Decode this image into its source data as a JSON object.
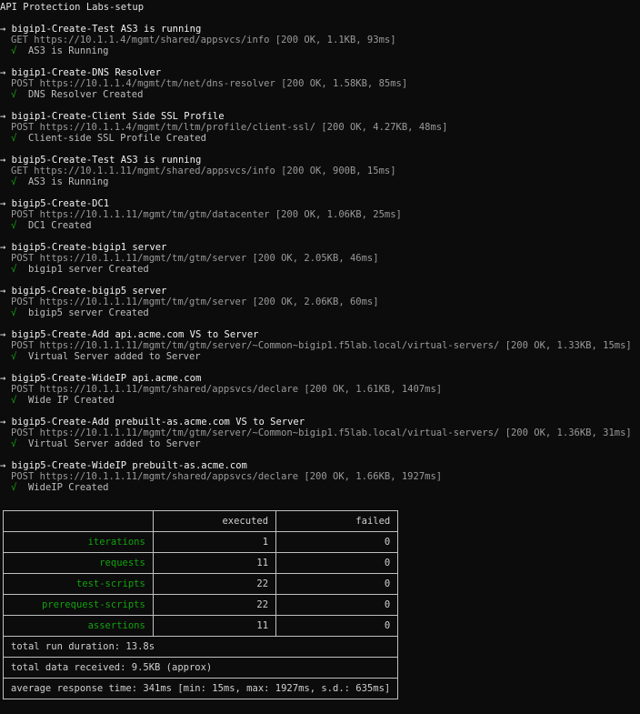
{
  "title": "API Protection Labs-setup",
  "arrow": "→",
  "check": "√",
  "requests": [
    {
      "name": "bigip1-Create-Test AS3 is running",
      "url": "GET https://10.1.1.4/mgmt/shared/appsvcs/info [200 OK, 1.1KB, 93ms]",
      "assertion": "AS3 is Running"
    },
    {
      "name": "bigip1-Create-DNS Resolver",
      "url": "POST https://10.1.1.4/mgmt/tm/net/dns-resolver [200 OK, 1.58KB, 85ms]",
      "assertion": "DNS Resolver Created"
    },
    {
      "name": "bigip1-Create-Client Side SSL Profile",
      "url": "POST https://10.1.1.4/mgmt/tm/ltm/profile/client-ssl/ [200 OK, 4.27KB, 48ms]",
      "assertion": "Client-side SSL Profile Created"
    },
    {
      "name": "bigip5-Create-Test AS3 is running",
      "url": "GET https://10.1.1.11/mgmt/shared/appsvcs/info [200 OK, 900B, 15ms]",
      "assertion": "AS3 is Running"
    },
    {
      "name": "bigip5-Create-DC1",
      "url": "POST https://10.1.1.11/mgmt/tm/gtm/datacenter [200 OK, 1.06KB, 25ms]",
      "assertion": "DC1 Created"
    },
    {
      "name": "bigip5-Create-bigip1 server",
      "url": "POST https://10.1.1.11/mgmt/tm/gtm/server [200 OK, 2.05KB, 46ms]",
      "assertion": "bigip1 server Created"
    },
    {
      "name": "bigip5-Create-bigip5 server",
      "url": "POST https://10.1.1.11/mgmt/tm/gtm/server [200 OK, 2.06KB, 60ms]",
      "assertion": "bigip5 server Created"
    },
    {
      "name": "bigip5-Create-Add api.acme.com VS to Server",
      "url": "POST https://10.1.1.11/mgmt/tm/gtm/server/~Common~bigip1.f5lab.local/virtual-servers/ [200 OK, 1.33KB, 15ms]",
      "assertion": "Virtual Server added to Server"
    },
    {
      "name": "bigip5-Create-WideIP api.acme.com",
      "url": "POST https://10.1.1.11/mgmt/shared/appsvcs/declare [200 OK, 1.61KB, 1407ms]",
      "assertion": "Wide IP Created"
    },
    {
      "name": "bigip5-Create-Add prebuilt-as.acme.com VS to Server",
      "url": "POST https://10.1.1.11/mgmt/tm/gtm/server/~Common~bigip1.f5lab.local/virtual-servers/ [200 OK, 1.36KB, 31ms]",
      "assertion": "Virtual Server added to Server"
    },
    {
      "name": "bigip5-Create-WideIP prebuilt-as.acme.com",
      "url": "POST https://10.1.1.11/mgmt/shared/appsvcs/declare [200 OK, 1.66KB, 1927ms]",
      "assertion": "WideIP Created"
    }
  ],
  "summary": {
    "header_executed": "executed",
    "header_failed": "failed",
    "rows": [
      {
        "label": "iterations",
        "executed": "1",
        "failed": "0"
      },
      {
        "label": "requests",
        "executed": "11",
        "failed": "0"
      },
      {
        "label": "test-scripts",
        "executed": "22",
        "failed": "0"
      },
      {
        "label": "prerequest-scripts",
        "executed": "22",
        "failed": "0"
      },
      {
        "label": "assertions",
        "executed": "11",
        "failed": "0"
      }
    ],
    "duration": "total run duration: 13.8s",
    "data_received": "total data received: 9.5KB (approx)",
    "response_time": "average response time: 341ms [min: 15ms, max: 1927ms, s.d.: 635ms]"
  },
  "colors": {
    "background": "#0c0c0c",
    "text": "#cccccc",
    "url": "#9a9a9a",
    "success": "#13a10e",
    "border": "#c0c0c0"
  }
}
